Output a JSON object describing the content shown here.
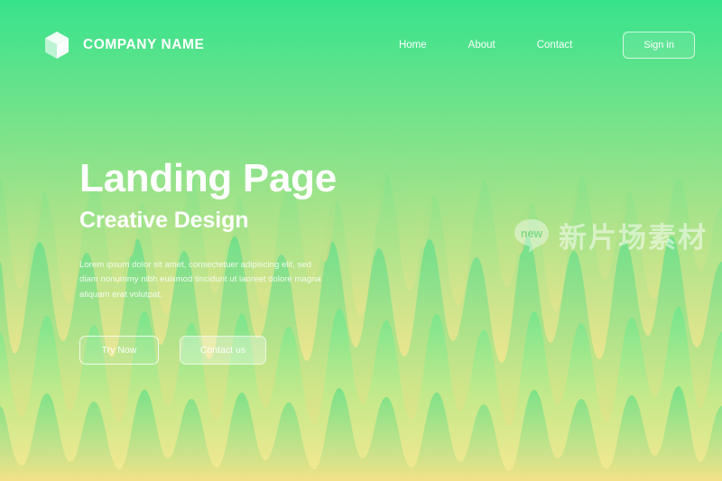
{
  "header": {
    "logo_icon": "cube-icon",
    "brand_name": "COMPANY NAME",
    "nav": [
      {
        "label": "Home"
      },
      {
        "label": "About"
      },
      {
        "label": "Contact"
      }
    ],
    "signin_label": "Sign in"
  },
  "hero": {
    "title": "Landing Page",
    "subtitle": "Creative Design",
    "paragraph": "Lorem ipsum dolor sit amet, consectetuer adipiscing elit, sed diam nonummy nibh euismod tincidunt ut laoreet dolore magna aliquam erat volutpat.",
    "primary_button": "Try Now",
    "secondary_button": "Contact us"
  },
  "watermark": {
    "badge_label": "new",
    "text": "新片场素材"
  },
  "colors": {
    "bg_top": "#12E089",
    "bg_mid": "#86E08A",
    "bg_bottom": "#F7E189",
    "text_on_hero": "#FFFFFF",
    "spike_light": "#BEE888",
    "spike_dark": "#0FD285"
  }
}
